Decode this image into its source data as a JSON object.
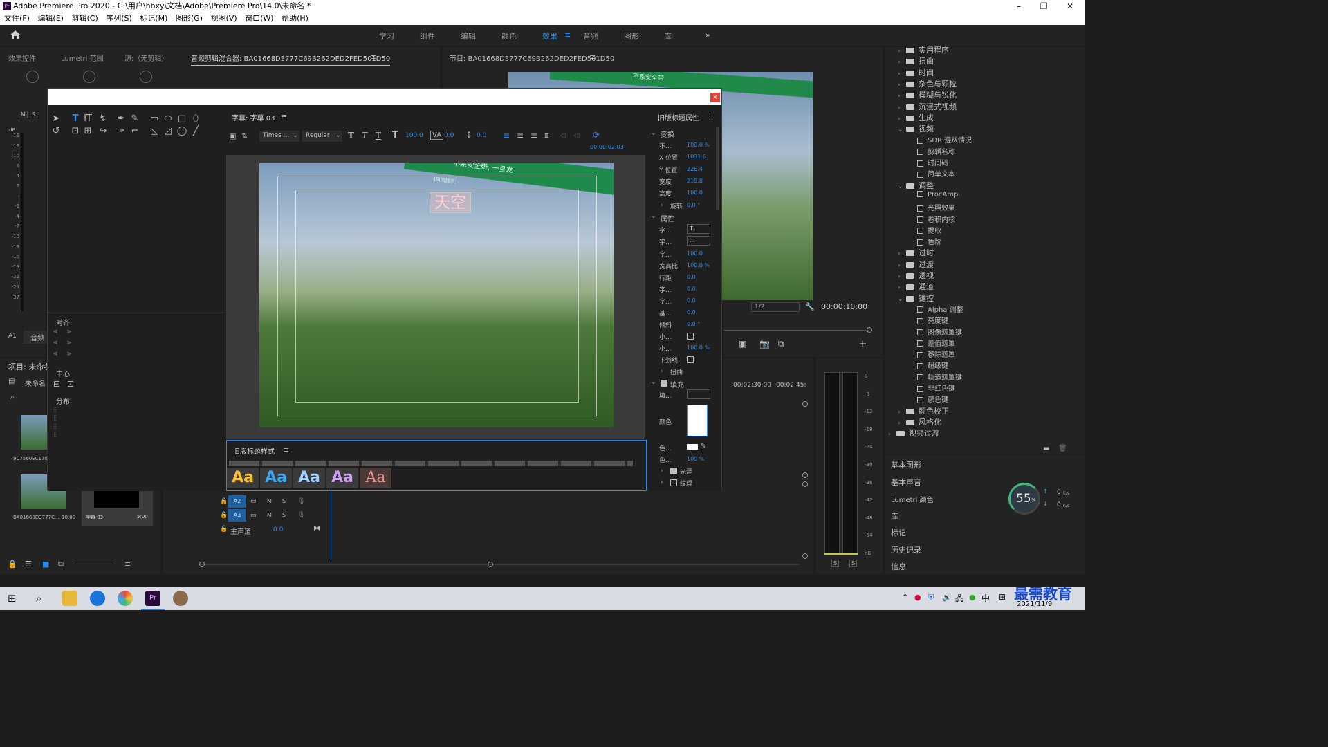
{
  "window": {
    "title": "Adobe Premiere Pro 2020 - C:\\用户\\hbxy\\文档\\Adobe\\Premiere Pro\\14.0\\未命名 *",
    "app_icon": "Pr"
  },
  "menu": [
    "文件(F)",
    "编辑(E)",
    "剪辑(C)",
    "序列(S)",
    "标记(M)",
    "图形(G)",
    "视图(V)",
    "窗口(W)",
    "帮助(H)"
  ],
  "workspaces": [
    "学习",
    "组件",
    "编辑",
    "颜色",
    "效果",
    "音频",
    "图形",
    "库"
  ],
  "left_panel": {
    "tabs": [
      "效果控件",
      "Lumetri 范围",
      "源:（无剪辑）",
      "音频剪辑混合器: BA01668D3777C69B262DED2FED501D50"
    ],
    "ms_buttons": [
      "M",
      "S"
    ],
    "db_scale": [
      "15",
      "12",
      "10",
      "6",
      "4",
      "2",
      "-",
      "-2",
      "-4",
      "-7",
      "-10",
      "-13",
      "-16",
      "-19",
      "-22",
      "-28",
      "-37"
    ],
    "db_label": "dB",
    "track_label": "A1",
    "track_name": "音频"
  },
  "program": {
    "tab": "节目: BA01668D3777C69B262DED2FED501D50",
    "sign_text": "不系安全带",
    "resolution": "1/2",
    "timecode": "00:00:10:00"
  },
  "project": {
    "tab": "项目: 未命名",
    "folder": "未命名",
    "clips": [
      {
        "name": "9C7560EC1704",
        "duration": ""
      },
      {
        "name": "BA01668D3777C...",
        "duration": "10:00"
      },
      {
        "name": "字幕 03",
        "duration": "5:00"
      }
    ]
  },
  "timeline": {
    "times": [
      "00:02:30:00",
      "00:02:45:"
    ],
    "tracks": [
      {
        "label": "A2",
        "m": "M",
        "s": "S"
      },
      {
        "label": "A3",
        "m": "M",
        "s": "S"
      }
    ],
    "master": {
      "label": "主声道",
      "value": "0.0"
    },
    "meter_scale": [
      "0",
      "-6",
      "-12",
      "-18",
      "-24",
      "-30",
      "-36",
      "-42",
      "-48",
      "-54",
      "dB"
    ],
    "meter_buttons": [
      "S",
      "S"
    ]
  },
  "titler": {
    "close": "×",
    "subtitle_tab": "字幕: 字幕 03",
    "font_family": "Times ...",
    "font_style": "Regular",
    "font_size": "100.0",
    "kerning": "0.0",
    "leading": "0.0",
    "timecode": "00:00:02:03",
    "caption_text": "天空",
    "sign_text_1": "不系安全带, 一旦发",
    "sign_text_2": "(风险提示)",
    "align_section": "对齐",
    "center_section": "中心",
    "distribute_section": "分布",
    "styles_tab": "旧版标题样式",
    "swatch_labels": [
      "Aa",
      "Aa",
      "Aa",
      "Aa",
      "Aa"
    ],
    "props_tab": "旧版标题属性",
    "transform": {
      "section": "变换",
      "rows": [
        {
          "label": "不...",
          "value": "100.0 %"
        },
        {
          "label": "X 位置",
          "value": "1031.6"
        },
        {
          "label": "Y 位置",
          "value": "226.4"
        },
        {
          "label": "宽度",
          "value": "219.8"
        },
        {
          "label": "高度",
          "value": "100.0"
        }
      ],
      "rotation_label": "旋转",
      "rotation_value": "0.0 °"
    },
    "attributes": {
      "section": "属性",
      "font_label": "字...",
      "font_value": "T...",
      "font_style_label": "字...",
      "font_style_value": "...",
      "rows": [
        {
          "label": "字...",
          "value": "100.0"
        },
        {
          "label": "宽高比",
          "value": "100.0 %"
        },
        {
          "label": "行距",
          "value": "0.0"
        },
        {
          "label": "字...",
          "value": "0.0"
        },
        {
          "label": "字...",
          "value": "0.0"
        },
        {
          "label": "基...",
          "value": "0.0"
        },
        {
          "label": "倾斜",
          "value": "0.0 °"
        }
      ],
      "smallcaps_label": "小...",
      "smallcaps_size_label": "小...",
      "smallcaps_size_value": "100.0 %",
      "underline_label": "下划线",
      "distort_label": "扭曲"
    },
    "fill": {
      "section": "填充",
      "type_label": "填...",
      "color_label": "颜色",
      "color2_label": "色...",
      "opacity_label": "色...",
      "opacity_value": "100 %",
      "sheen_label": "光泽",
      "texture_label": "纹理"
    }
  },
  "effects_tree": [
    {
      "kind": "folder",
      "label": "实用程序",
      "open": false,
      "indent": 1
    },
    {
      "kind": "folder",
      "label": "扭曲",
      "open": false,
      "indent": 1
    },
    {
      "kind": "folder",
      "label": "时间",
      "open": false,
      "indent": 1
    },
    {
      "kind": "folder",
      "label": "杂色与颗粒",
      "open": false,
      "indent": 1
    },
    {
      "kind": "folder",
      "label": "模糊与锐化",
      "open": false,
      "indent": 1
    },
    {
      "kind": "folder",
      "label": "沉浸式视频",
      "open": false,
      "indent": 1
    },
    {
      "kind": "folder",
      "label": "生成",
      "open": false,
      "indent": 1
    },
    {
      "kind": "folder",
      "label": "视频",
      "open": true,
      "indent": 1
    },
    {
      "kind": "fx",
      "label": "SDR 遵从情况",
      "indent": 2
    },
    {
      "kind": "fx",
      "label": "剪辑名称",
      "indent": 2
    },
    {
      "kind": "fx",
      "label": "时间码",
      "indent": 2
    },
    {
      "kind": "fx",
      "label": "简单文本",
      "indent": 2
    },
    {
      "kind": "folder",
      "label": "调整",
      "open": true,
      "indent": 1
    },
    {
      "kind": "fx",
      "label": "ProcAmp",
      "indent": 2
    },
    {
      "kind": "fx",
      "label": "光照效果",
      "indent": 2
    },
    {
      "kind": "fx",
      "label": "卷积内核",
      "indent": 2
    },
    {
      "kind": "fx",
      "label": "提取",
      "indent": 2
    },
    {
      "kind": "fx",
      "label": "色阶",
      "indent": 2
    },
    {
      "kind": "folder",
      "label": "过时",
      "open": false,
      "indent": 1
    },
    {
      "kind": "folder",
      "label": "过渡",
      "open": false,
      "indent": 1
    },
    {
      "kind": "folder",
      "label": "透视",
      "open": false,
      "indent": 1
    },
    {
      "kind": "folder",
      "label": "通道",
      "open": false,
      "indent": 1
    },
    {
      "kind": "folder",
      "label": "键控",
      "open": true,
      "indent": 1
    },
    {
      "kind": "fx",
      "label": "Alpha 调整",
      "indent": 2
    },
    {
      "kind": "fx",
      "label": "亮度键",
      "indent": 2
    },
    {
      "kind": "fx",
      "label": "图像遮罩键",
      "indent": 2
    },
    {
      "kind": "fx",
      "label": "差值遮罩",
      "indent": 2
    },
    {
      "kind": "fx",
      "label": "移除遮罩",
      "indent": 2
    },
    {
      "kind": "fx",
      "label": "超级键",
      "indent": 2
    },
    {
      "kind": "fx",
      "label": "轨道遮罩键",
      "indent": 2
    },
    {
      "kind": "fx",
      "label": "非红色键",
      "indent": 2
    },
    {
      "kind": "fx",
      "label": "颜色键",
      "indent": 2
    },
    {
      "kind": "folder",
      "label": "颜色校正",
      "open": false,
      "indent": 1
    },
    {
      "kind": "folder",
      "label": "风格化",
      "open": false,
      "indent": 1
    },
    {
      "kind": "folder",
      "label": "视频过渡",
      "open": false,
      "indent": 0
    }
  ],
  "side_panels": [
    "基本图形",
    "基本声音",
    "Lumetri 颜色",
    "库",
    "标记",
    "历史记录",
    "信息"
  ],
  "net_widget": {
    "percent": "55",
    "unit": "%",
    "up": "0",
    "down": "0",
    "rate_unit": "K/s"
  },
  "taskbar": {
    "ime": "中",
    "date": "2021/11/9",
    "watermark": "最需教育"
  },
  "colors": {
    "accent": "#2d8ceb",
    "close": "#e0453a",
    "track_active": "#1f5f9e"
  }
}
